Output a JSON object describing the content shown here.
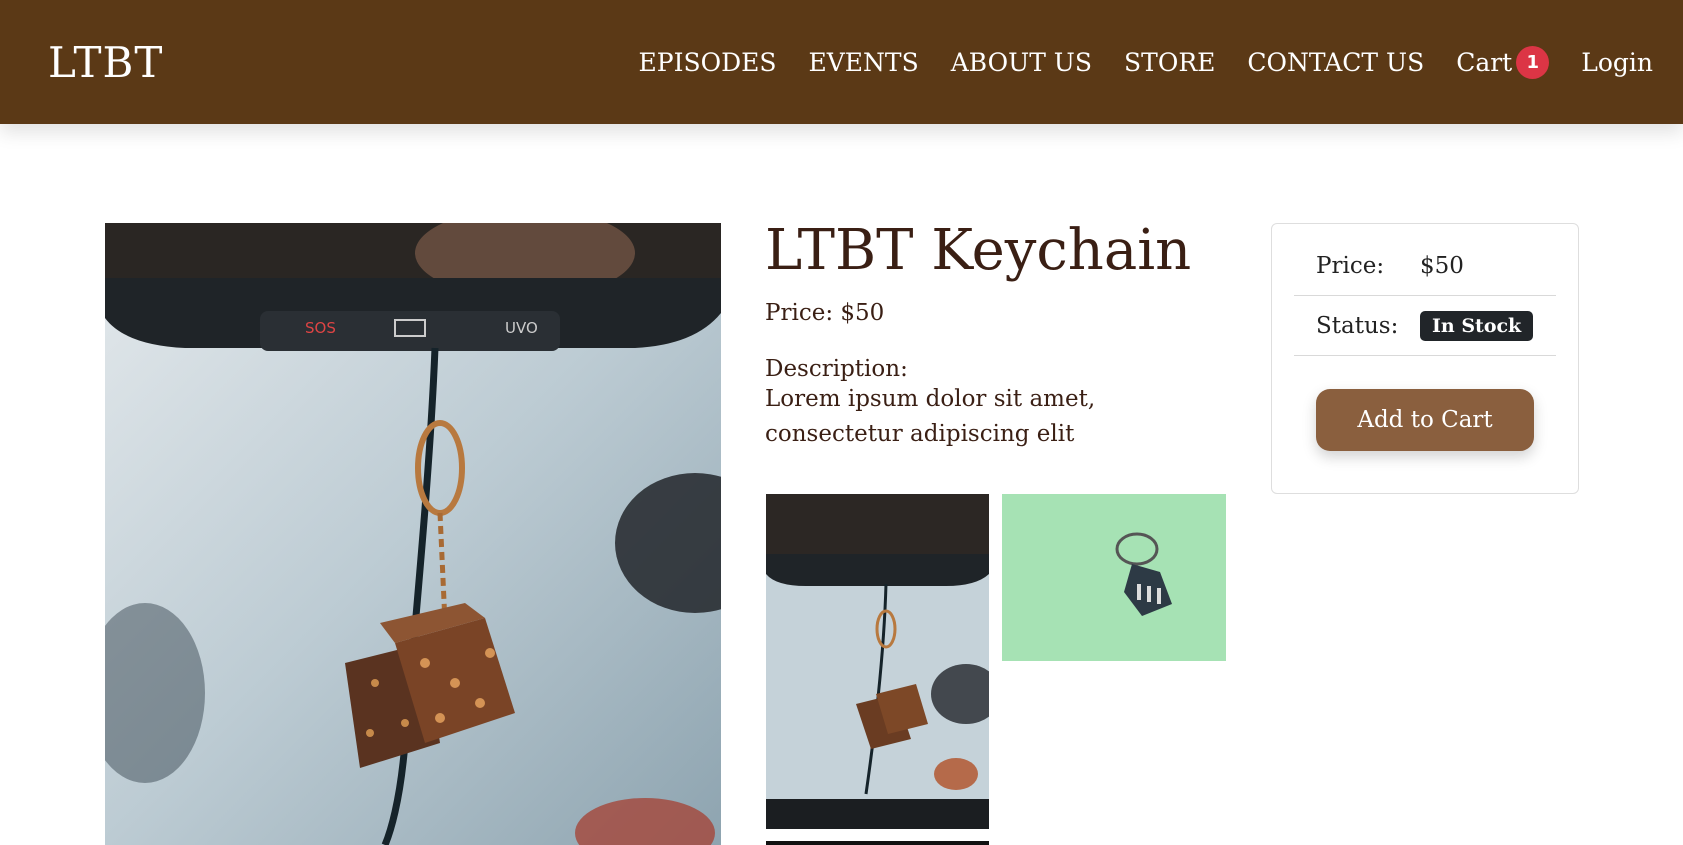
{
  "navbar": {
    "brand": "LTBT",
    "links": {
      "episodes": "EPISODES",
      "events": "EVENTS",
      "about": "ABOUT US",
      "store": "STORE",
      "contact": "CONTACT US",
      "cart": "Cart",
      "cart_count": "1",
      "login": "Login"
    }
  },
  "product": {
    "title": "LTBT Keychain",
    "price_line": "Price: $50",
    "description_label": "Description:",
    "description": "Lorem ipsum dolor sit amet, consectetur adipiscing elit"
  },
  "dashboard_labels": {
    "sos": "SOS",
    "uvo": "UVO"
  },
  "card": {
    "price_label": "Price:",
    "price_value": "$50",
    "status_label": "Status:",
    "status_value": "In Stock",
    "add_button": "Add to Cart"
  },
  "colors": {
    "navbar_bg": "#5b3916",
    "title_text": "#3a1f14",
    "cart_badge": "#dc3545",
    "stock_badge": "#212529",
    "add_button": "#8a5f3e",
    "thumb_green": "#a4e0b2"
  },
  "icons": {
    "main_image": "dice-keychain-photo",
    "thumb_1": "dice-keychain-photo",
    "thumb_2": "house-keychain-photo"
  }
}
